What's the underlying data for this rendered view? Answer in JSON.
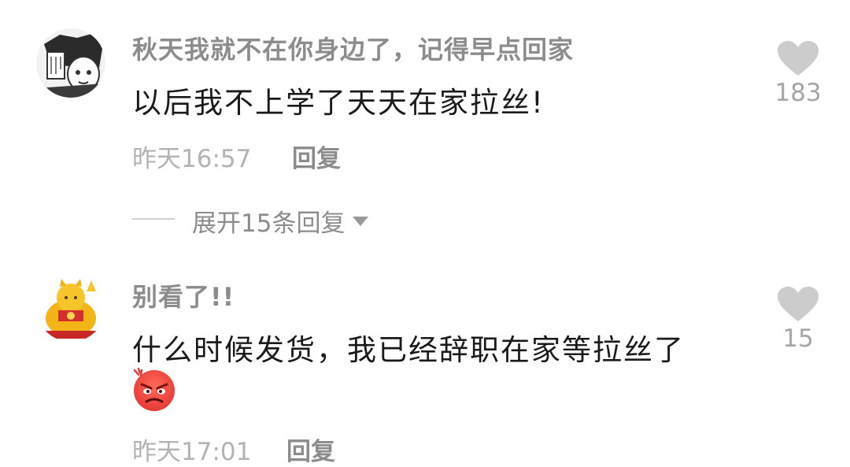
{
  "comments": [
    {
      "username": "秋天我就不在你身边了，记得早点回家",
      "content": "以后我不上学了天天在家拉丝!",
      "time": "昨天16:57",
      "reply_label": "回复",
      "likes": "183",
      "avatar_icon": "manga-character-avatar"
    },
    {
      "username": "别看了!!",
      "content": "什么时候发货，我已经辞职在家等拉丝了",
      "emoji_icon": "angry-face-emoji",
      "time": "昨天17:01",
      "reply_label": "回复",
      "likes": "15",
      "avatar_icon": "lucky-cat-avatar"
    }
  ],
  "expand_replies_label": "展开15条回复",
  "colors": {
    "username": "#8c8c8c",
    "content": "#1a1a1a",
    "meta": "#b3b3b3",
    "heart": "#cccccc",
    "angry_emoji": "#e53935"
  }
}
